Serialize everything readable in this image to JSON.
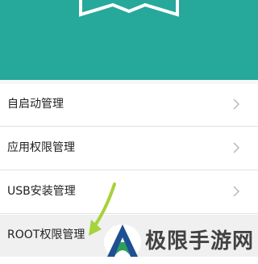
{
  "header": {
    "accent_color": "#26a89b",
    "emblem_icon": "ribbon-icon"
  },
  "menu": {
    "items": [
      {
        "label": "自启动管理",
        "chevron_icon": "chevron-right-icon"
      },
      {
        "label": "应用权限管理",
        "chevron_icon": "chevron-right-icon"
      },
      {
        "label": "USB安装管理",
        "chevron_icon": "chevron-right-icon"
      },
      {
        "label": "ROOT权限管理"
      }
    ]
  },
  "overlay": {
    "arrow_icon": "pointer-arrow-icon",
    "arrow_color": "#a6d23a"
  },
  "watermark": {
    "text": "极限手游网",
    "logo_icon": "site-logo-icon"
  }
}
